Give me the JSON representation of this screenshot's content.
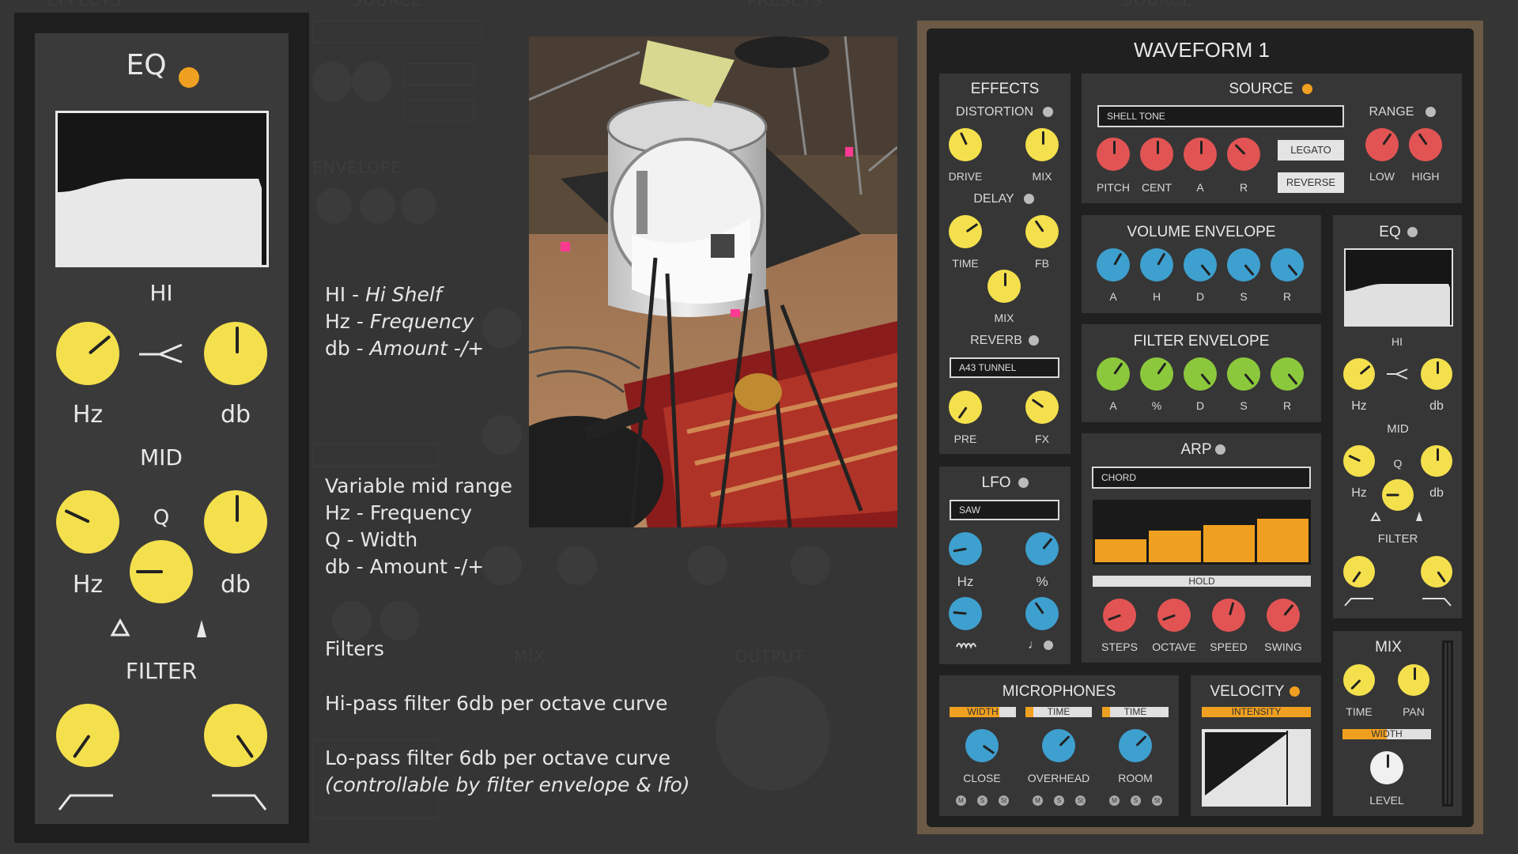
{
  "colors": {
    "knob_yellow": "#f4e04d",
    "knob_blue": "#3ea0cf",
    "knob_red": "#e25454",
    "knob_green": "#8cc83c",
    "knob_white": "#f0f0f0",
    "accent_orange": "#f0a020",
    "led_grey": "#bbbbbb"
  },
  "background": {
    "labels": [
      "EFFECTS",
      "SOURCE",
      "PRESETS",
      "ENVELOPE",
      "OUTPUT",
      "SOURCE",
      "MIX"
    ]
  },
  "eq_panel": {
    "title": "EQ",
    "title_led": "orange",
    "hi_label": "HI",
    "hi_shelf_icon": "shelf-icon",
    "hi_hz_label": "Hz",
    "hi_db_label": "db",
    "mid_label": "MID",
    "q_label": "Q",
    "mid_hz_label": "Hz",
    "mid_db_label": "db",
    "narrow_icon": "triangle-outline-icon",
    "wide_icon": "triangle-filled-icon",
    "filter_label": "FILTER",
    "hipass_icon": "hipass-curve-icon",
    "lopass_icon": "lopass-curve-icon"
  },
  "notes": {
    "hi_key": "HI - ",
    "hi_val": "Hi Shelf",
    "hz_key": "Hz - ",
    "hz_val": "Frequency",
    "db_key": "db - ",
    "db_val": "Amount -/+",
    "mid_lines": [
      "Variable mid range",
      "Hz - Frequency",
      "Q - Width",
      "db - Amount -/+"
    ],
    "filters_title": "Filters",
    "hipass_line": "Hi-pass filter 6db per octave curve",
    "lopass_line": "Lo-pass filter 6db per octave curve",
    "lopass_sub": "(controllable by filter envelope & lfo)"
  },
  "plugin": {
    "title": "WAVEFORM 1",
    "effects": {
      "title": "EFFECTS",
      "distortion": "DISTORTION",
      "drive": "DRIVE",
      "mix": "MIX",
      "delay": "DELAY",
      "time": "TIME",
      "fb": "FB",
      "delay_mix": "MIX",
      "reverb": "REVERB",
      "reverb_type": "A43 TUNNEL",
      "pre": "PRE",
      "fx": "FX"
    },
    "source": {
      "title": "SOURCE",
      "sample": "SHELL TONE",
      "knobs": [
        "PITCH",
        "CENT",
        "A",
        "R"
      ],
      "legato": "LEGATO",
      "reverse": "REVERSE",
      "range": "RANGE",
      "low": "LOW",
      "high": "HIGH"
    },
    "volume_env": {
      "title": "VOLUME ENVELOPE",
      "knobs": [
        "A",
        "H",
        "D",
        "S",
        "R"
      ]
    },
    "filter_env": {
      "title": "FILTER ENVELOPE",
      "knobs": [
        "A",
        "%",
        "D",
        "S",
        "R"
      ]
    },
    "lfo": {
      "title": "LFO",
      "shape": "SAW",
      "hz": "Hz",
      "pct": "%",
      "wave_icon": "wave-icon",
      "note_icon": "note-icon",
      "note_glyph": "♩"
    },
    "arp": {
      "title": "ARP",
      "mode": "CHORD",
      "steps_levels": [
        0.38,
        0.52,
        0.62,
        0.72
      ],
      "hold": "HOLD",
      "knobs": [
        "STEPS",
        "OCTAVE",
        "SPEED",
        "SWING"
      ]
    },
    "eq": {
      "title": "EQ",
      "hi": "HI",
      "hz": "Hz",
      "db": "db",
      "mid": "MID",
      "q": "Q",
      "mid_hz": "Hz",
      "mid_db": "db",
      "filter": "FILTER"
    },
    "microphones": {
      "title": "MICROPHONES",
      "tags": [
        "WIDTH",
        "TIME",
        "TIME"
      ],
      "knobs": [
        "CLOSE",
        "OVERHEAD",
        "ROOM"
      ],
      "mini_labels": [
        "M",
        "S",
        "St"
      ]
    },
    "velocity": {
      "title": "VELOCITY",
      "intensity": "INTENSITY"
    },
    "mix": {
      "title": "MIX",
      "time": "TIME",
      "pan": "PAN",
      "width": "WIDTH",
      "level": "LEVEL"
    }
  }
}
